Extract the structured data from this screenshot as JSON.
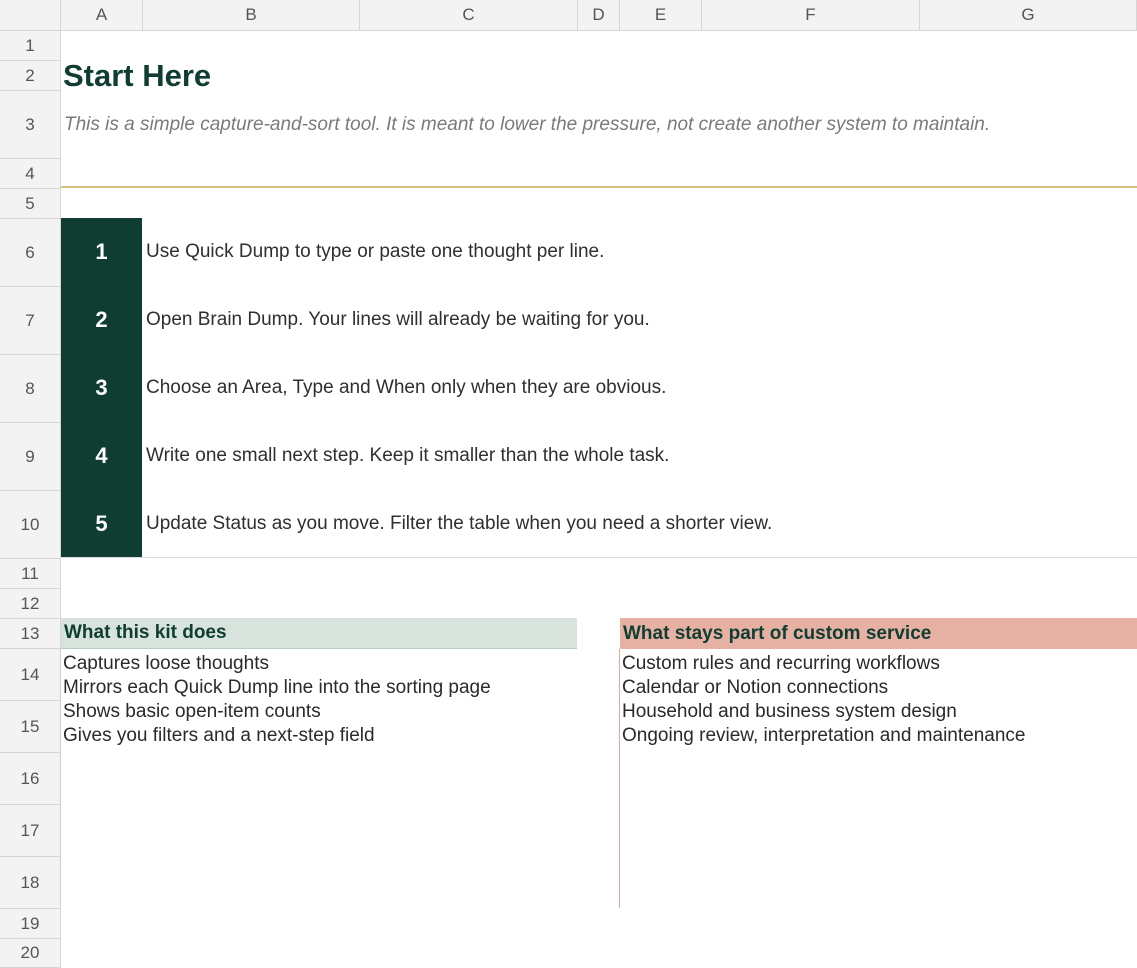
{
  "columns": [
    "A",
    "B",
    "C",
    "D",
    "E",
    "F",
    "G"
  ],
  "rows": [
    "1",
    "2",
    "3",
    "4",
    "5",
    "6",
    "7",
    "8",
    "9",
    "10",
    "11",
    "12",
    "13",
    "14",
    "15",
    "16",
    "17",
    "18",
    "19",
    "20"
  ],
  "sheet": {
    "title": "Start Here",
    "subtitle": "This is a simple capture-and-sort tool. It is meant to lower the pressure, not create another system to maintain.",
    "steps": [
      {
        "num": "1",
        "text": "Use Quick Dump to type or paste one thought per line."
      },
      {
        "num": "2",
        "text": "Open Brain Dump. Your lines will already be waiting for you."
      },
      {
        "num": "3",
        "text": "Choose an Area, Type and When only when they are obvious."
      },
      {
        "num": "4",
        "text": "Write one small next step. Keep it smaller than the whole task."
      },
      {
        "num": "5",
        "text": "Update Status as you move. Filter the table when you need a shorter view."
      }
    ],
    "kit_does": {
      "header": "What this kit does",
      "items": [
        "Captures loose thoughts",
        "Mirrors each Quick Dump line into the sorting page",
        "Shows basic open-item counts",
        "Gives you filters and a next-step field"
      ]
    },
    "custom_service": {
      "header": "What stays part of custom service",
      "items": [
        "Custom rules and recurring workflows",
        "Calendar or Notion connections",
        "Household and business system design",
        "Ongoing review, interpretation and maintenance"
      ]
    }
  },
  "colors": {
    "dark_green": "#0f3d32",
    "light_green_header": "#d7e3dc",
    "salmon_header": "#e6b1a3",
    "gold_rule": "#d9bf86"
  }
}
